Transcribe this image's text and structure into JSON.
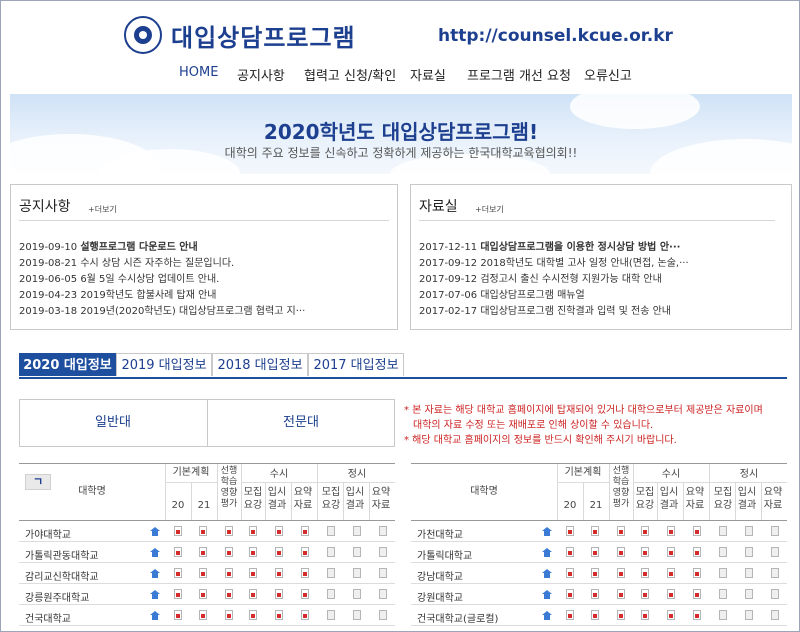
{
  "header": {
    "logo_text": "대입상담프로그램",
    "url": "http://counsel.kcue.or.kr"
  },
  "nav": [
    {
      "label": "HOME"
    },
    {
      "label": "공지사항"
    },
    {
      "label": "협력고 신청/확인"
    },
    {
      "label": "자료실"
    },
    {
      "label": "프로그램 개선 요청"
    },
    {
      "label": "오류신고"
    }
  ],
  "banner": {
    "title": "2020학년도 대입상담프로그램!",
    "subtitle": "대학의 주요 정보를 신속하고 정확하게 제공하는 한국대학교육협의회!!"
  },
  "notices": {
    "title": "공지사항",
    "more": "+더보기",
    "items": [
      {
        "date": "2019-09-10",
        "text": "설행프로그램 다운로드 안내",
        "bold": true
      },
      {
        "date": "2019-08-21",
        "text": "수시 상담 시즌 자주하는 질문입니다."
      },
      {
        "date": "2019-06-05",
        "text": "6월 5일 수시상담 업데이트 안내."
      },
      {
        "date": "2019-04-23",
        "text": "2019학년도 합불사례 탑재 안내"
      },
      {
        "date": "2019-03-18",
        "text": "2019년(2020학년도) 대입상담프로그램 협력고 지···"
      }
    ]
  },
  "library": {
    "title": "자료실",
    "more": "+더보기",
    "items": [
      {
        "date": "2017-12-11",
        "text": "대입상담프로그램을 이용한 정시상담 방법 안···",
        "bold": true
      },
      {
        "date": "2017-09-12",
        "text": "2018학년도 대학별 고사 일정 안내(면접, 논술,···"
      },
      {
        "date": "2017-09-12",
        "text": "검정고시 출신 수시전형 지원가능 대학 안내"
      },
      {
        "date": "2017-07-06",
        "text": "대입상담프로그램 매뉴얼"
      },
      {
        "date": "2017-02-17",
        "text": "대입상담프로그램 진학결과 입력 및 전송 안내"
      }
    ]
  },
  "tabs": [
    {
      "label": "2020 대입정보",
      "active": true
    },
    {
      "label": "2019 대입정보"
    },
    {
      "label": "2018 대입정보"
    },
    {
      "label": "2017 대입정보"
    }
  ],
  "types": {
    "general": "일반대",
    "junior": "전문대"
  },
  "notice_lines": [
    "* 본 자료는 해당 대학교 홈페이지에 탑재되어 있거나 대학으로부터 제공받은 자료이며",
    "대학의 자료 수정 또는 재배포로 인해 상이할 수 있습니다.",
    "* 해당 대학교 홈페이지의 정보를 반드시 확인해 주시기 바랍니다."
  ],
  "table": {
    "index_letter": "ㄱ",
    "col_university": "대학명",
    "group_basic": "기본계획",
    "basic_years": [
      "20",
      "21"
    ],
    "group_sunhaeng": "선행학습영향평가",
    "group_susi": "수시",
    "group_jeongsi": "정시",
    "sub_cols": [
      "모집요강",
      "입시결과",
      "요약자료"
    ]
  },
  "left_universities": [
    "가야대학교",
    "가톨릭관동대학교",
    "감리교신학대학교",
    "강릉원주대학교",
    "건국대학교"
  ],
  "right_universities": [
    "가천대학교",
    "가톨릭대학교",
    "강남대학교",
    "강원대학교",
    "건국대학교(글로컬)"
  ],
  "colors": {
    "primary": "#1d3f8f",
    "tab_active": "#1d4f9e",
    "notice_red": "#cc2222"
  },
  "icons": {
    "home": "home-icon",
    "pdf": "pdf-icon"
  }
}
